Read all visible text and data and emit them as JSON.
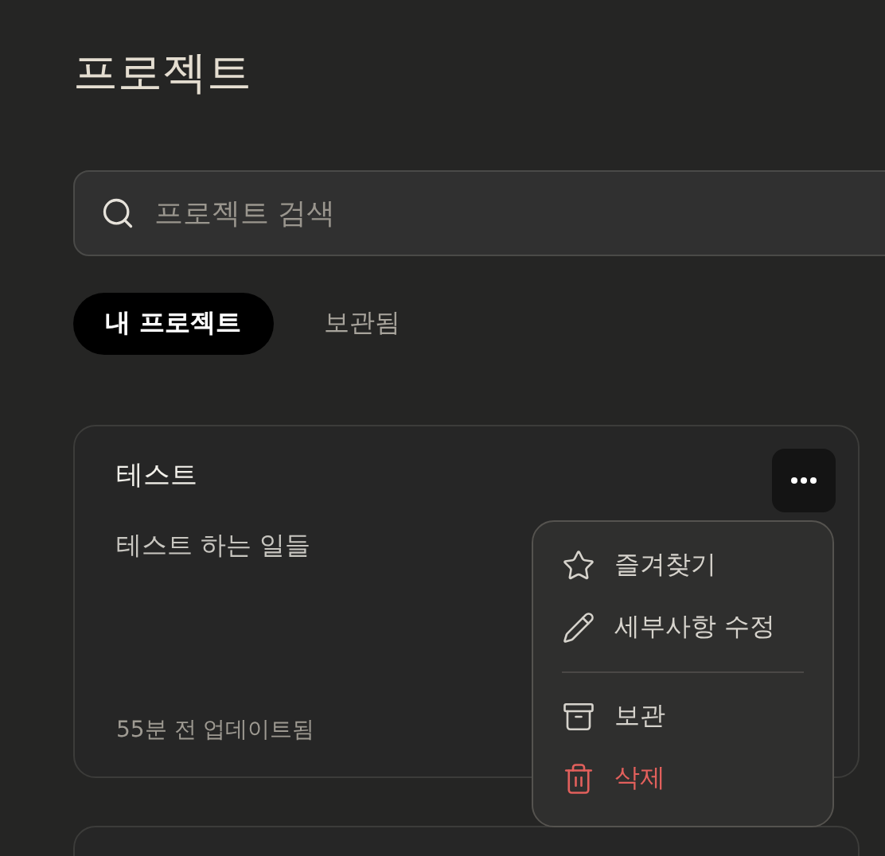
{
  "page": {
    "title": "프로젝트"
  },
  "search": {
    "placeholder": "프로젝트 검색"
  },
  "tabs": [
    {
      "label": "내 프로젝트",
      "selected": true
    },
    {
      "label": "보관됨",
      "selected": false
    }
  ],
  "projects": [
    {
      "name": "테스트",
      "description": "테스트 하는 일들",
      "updated": "55분 전 업데이트됨",
      "menu_open": true
    }
  ],
  "menu": {
    "groups": [
      [
        {
          "kind": "favorite",
          "label": "즐겨찾기"
        },
        {
          "kind": "edit",
          "label": "세부사항 수정"
        }
      ],
      [
        {
          "kind": "archive",
          "label": "보관"
        },
        {
          "kind": "delete",
          "label": "삭제"
        }
      ]
    ]
  }
}
